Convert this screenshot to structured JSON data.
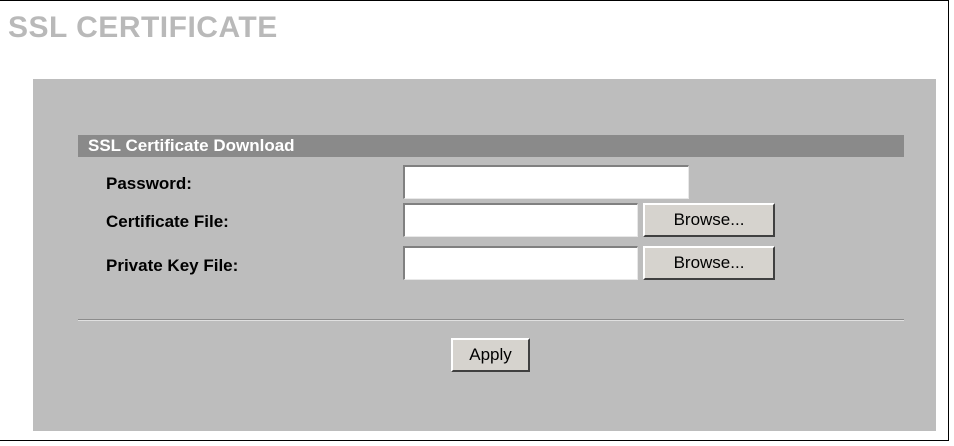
{
  "page": {
    "title": "SSL CERTIFICATE"
  },
  "section": {
    "title": "SSL Certificate Download"
  },
  "fields": {
    "password": {
      "label": "Password:",
      "value": ""
    },
    "certificate_file": {
      "label": "Certificate File:",
      "value": "",
      "button_label": "Browse..."
    },
    "private_key_file": {
      "label": "Private Key File:",
      "value": "",
      "button_label": "Browse..."
    }
  },
  "actions": {
    "apply_label": "Apply"
  },
  "colors": {
    "panel_background": "#bdbdbd",
    "section_header_background": "#8a8a8a",
    "title_text": "#b9b9b9"
  }
}
